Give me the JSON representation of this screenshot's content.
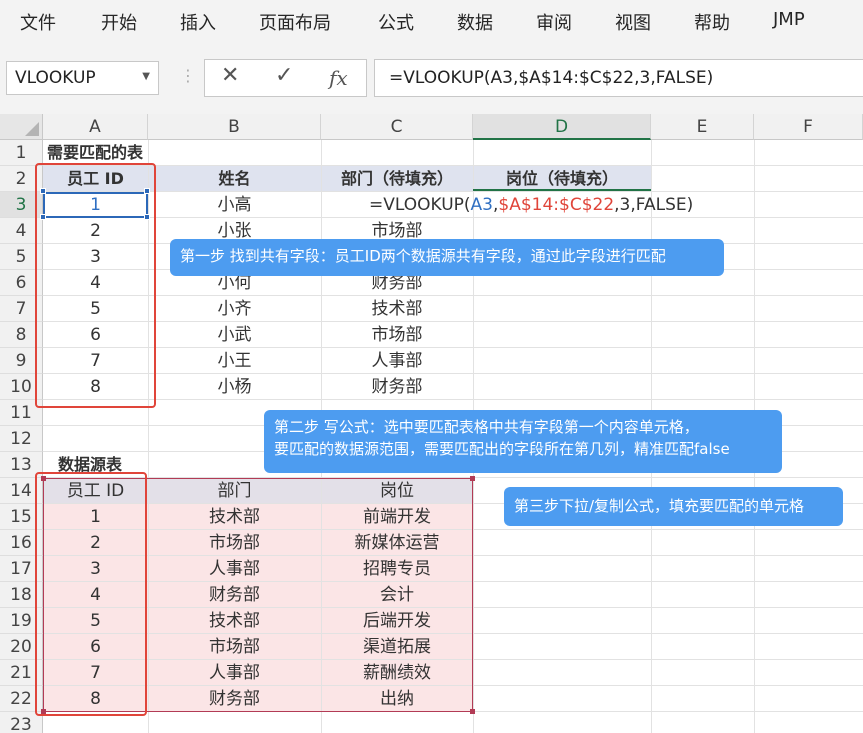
{
  "ribbon": {
    "tabs": [
      "文件",
      "开始",
      "插入",
      "页面布局",
      "公式",
      "数据",
      "审阅",
      "视图",
      "帮助",
      "JMP"
    ]
  },
  "formula_bar": {
    "name_box": "VLOOKUP",
    "cancel": "✕",
    "enter": "✓",
    "fx": "fx",
    "formula": "=VLOOKUP(A3,$A$14:$C$22,3,FALSE)"
  },
  "columns": [
    "A",
    "B",
    "C",
    "D",
    "E",
    "F"
  ],
  "rows": [
    "1",
    "2",
    "3",
    "4",
    "5",
    "6",
    "7",
    "8",
    "9",
    "10",
    "11",
    "12",
    "13",
    "14",
    "15",
    "16",
    "17",
    "18",
    "19",
    "20",
    "21",
    "22",
    "23"
  ],
  "table1": {
    "title": "需要匹配的表",
    "headers": [
      "员工 ID",
      "姓名",
      "部门（待填充）",
      "岗位（待填充）"
    ],
    "rows": [
      [
        "1",
        "小高",
        ""
      ],
      [
        "2",
        "小张",
        "市场部"
      ],
      [
        "3",
        "",
        ""
      ],
      [
        "4",
        "小何",
        "财务部"
      ],
      [
        "5",
        "小齐",
        "技术部"
      ],
      [
        "6",
        "小武",
        "市场部"
      ],
      [
        "7",
        "小王",
        "人事部"
      ],
      [
        "8",
        "小杨",
        "财务部"
      ]
    ],
    "c3_formula": {
      "prefix": "=VLOOKUP(",
      "ref1": "A3",
      "comma1": ",",
      "ref2": "$A$14:$C$22",
      "suffix": ",3,FALSE)"
    }
  },
  "table2": {
    "title": "数据源表",
    "headers": [
      "员工 ID",
      "部门",
      "岗位"
    ],
    "rows": [
      [
        "1",
        "技术部",
        "前端开发"
      ],
      [
        "2",
        "市场部",
        "新媒体运营"
      ],
      [
        "3",
        "人事部",
        "招聘专员"
      ],
      [
        "4",
        "财务部",
        "会计"
      ],
      [
        "5",
        "技术部",
        "后端开发"
      ],
      [
        "6",
        "市场部",
        "渠道拓展"
      ],
      [
        "7",
        "人事部",
        "薪酬绩效"
      ],
      [
        "8",
        "财务部",
        "出纳"
      ]
    ]
  },
  "callouts": {
    "step1": "第一步 找到共有字段：员工ID两个数据源共有字段，通过此字段进行匹配",
    "step2_line1": "第二步 写公式：选中要匹配表格中共有字段第一个内容单元格，",
    "step2_line2": "要匹配的数据源范围，需要匹配出的字段所在第几列，精准匹配false",
    "step3": "第三步下拉/复制公式，填充要匹配的单元格"
  },
  "colors": {
    "accent_green": "#217346",
    "callout_blue": "#4d9cf0",
    "highlight_red": "#e0453a",
    "header_fill": "#dfe3ef",
    "source_fill": "#fbe5e6"
  }
}
